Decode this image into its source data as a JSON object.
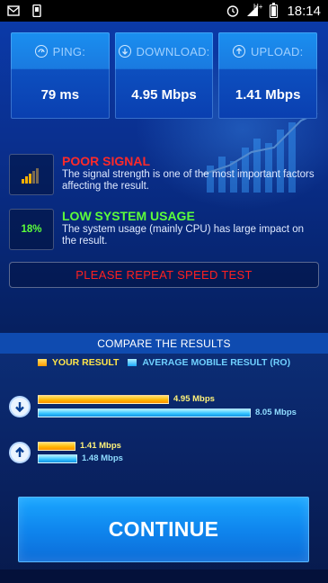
{
  "status_bar": {
    "time": "18:14",
    "network_label": "H+",
    "left_icons": [
      "mail-icon",
      "phone-icon"
    ],
    "right_icons": [
      "alarm-icon",
      "signal-icon",
      "battery-icon"
    ]
  },
  "metrics": [
    {
      "label": "PING:",
      "value": "79 ms",
      "icon": "ping-icon"
    },
    {
      "label": "DOWNLOAD:",
      "value": "4.95 Mbps",
      "icon": "download-icon"
    },
    {
      "label": "UPLOAD:",
      "value": "1.41 Mbps",
      "icon": "upload-icon"
    }
  ],
  "signal": {
    "title": "POOR SIGNAL",
    "description": "The signal strength is one of the most important factors affecting the result.",
    "color": "#ff2a2a"
  },
  "system": {
    "badge": "18%",
    "title": "LOW SYSTEM USAGE",
    "description": "The system usage (mainly CPU) has large impact on the result.",
    "color": "#5cff3a"
  },
  "warning": {
    "text": "PLEASE REPEAT SPEED TEST"
  },
  "compare": {
    "title": "COMPARE THE RESULTS",
    "legend": {
      "yours": "YOUR RESULT",
      "average": "AVERAGE MOBILE RESULT (RO)"
    },
    "download": {
      "yours_label": "4.95 Mbps",
      "average_label": "8.05 Mbps",
      "yours_value": 4.95,
      "average_value": 8.05
    },
    "upload": {
      "yours_label": "1.41 Mbps",
      "average_label": "1.48 Mbps",
      "yours_value": 1.41,
      "average_value": 1.48
    }
  },
  "continue_button": {
    "label": "CONTINUE"
  },
  "colors": {
    "your_result": "#ffc400",
    "average_result": "#27b8ff",
    "accent": "#1a8ff0"
  }
}
